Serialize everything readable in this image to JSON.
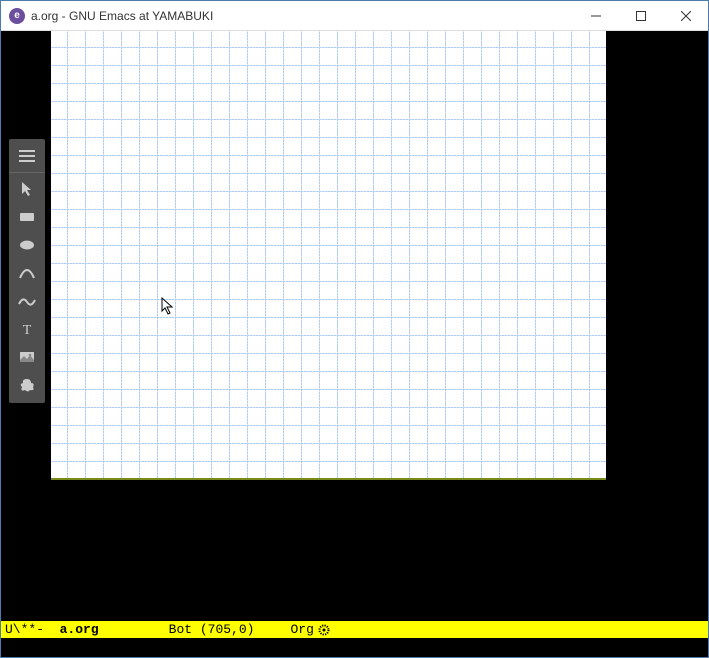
{
  "window": {
    "title": "a.org - GNU Emacs at YAMABUKI"
  },
  "toolbar": {
    "items": [
      {
        "name": "menu-icon",
        "label": "Menu"
      },
      {
        "name": "pointer-icon",
        "label": "Pointer"
      },
      {
        "name": "rectangle-icon",
        "label": "Rectangle"
      },
      {
        "name": "ellipse-icon",
        "label": "Ellipse"
      },
      {
        "name": "arc-icon",
        "label": "Arc"
      },
      {
        "name": "curve-icon",
        "label": "Curve"
      },
      {
        "name": "text-icon",
        "label": "Text"
      },
      {
        "name": "image-icon",
        "label": "Image"
      },
      {
        "name": "freeform-icon",
        "label": "Freeform"
      }
    ]
  },
  "modeline": {
    "encoding": "U\\**- ",
    "buffer": "a.org",
    "position": "Bot (705,0)",
    "mode": "Org"
  }
}
